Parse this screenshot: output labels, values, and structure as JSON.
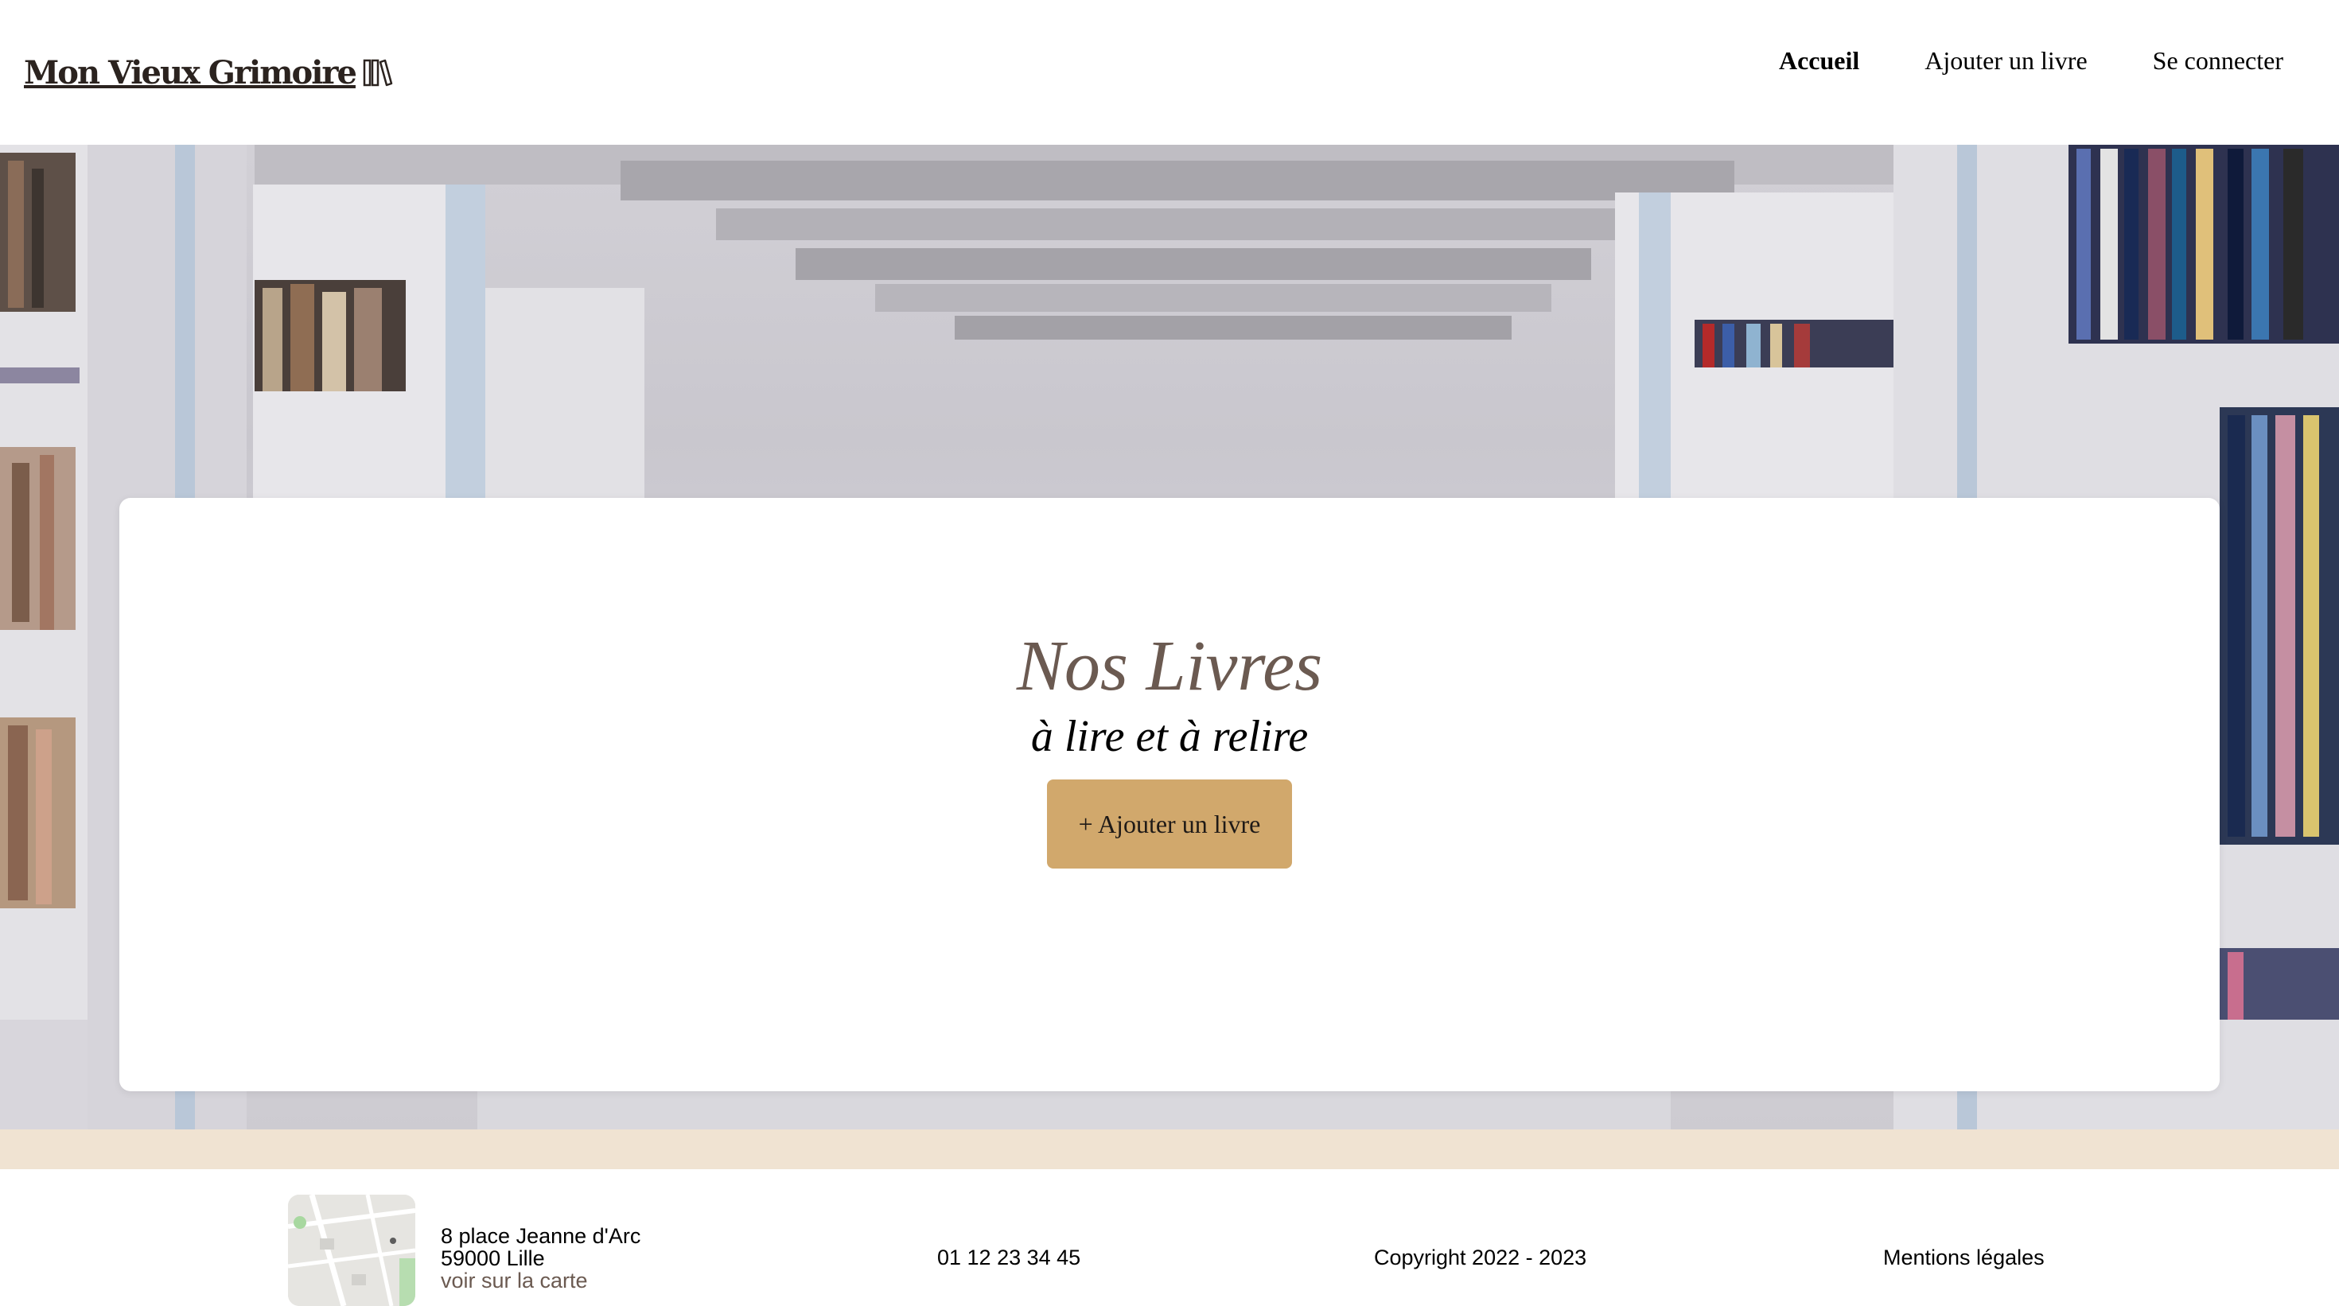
{
  "header": {
    "logo_text": "Mon Vieux Grimoire",
    "logo_icon": "books-icon",
    "nav": [
      {
        "label": "Accueil",
        "active": true
      },
      {
        "label": "Ajouter un livre",
        "active": false
      },
      {
        "label": "Se connecter",
        "active": false
      }
    ]
  },
  "hero": {
    "title": "Nos Livres",
    "subtitle": "à lire et à relire",
    "add_button_label": "+ Ajouter un livre"
  },
  "footer": {
    "address_line1": "8 place Jeanne d'Arc",
    "address_line2": "59000 Lille",
    "map_link": "voir sur la carte",
    "phone": "01 12 23 34 45",
    "copyright": "Copyright 2022 - 2023",
    "legal": "Mentions légales"
  },
  "colors": {
    "accent_button": "#d1a86c",
    "title_brown": "#6b5a51",
    "band_beige": "#f0e3d2"
  }
}
